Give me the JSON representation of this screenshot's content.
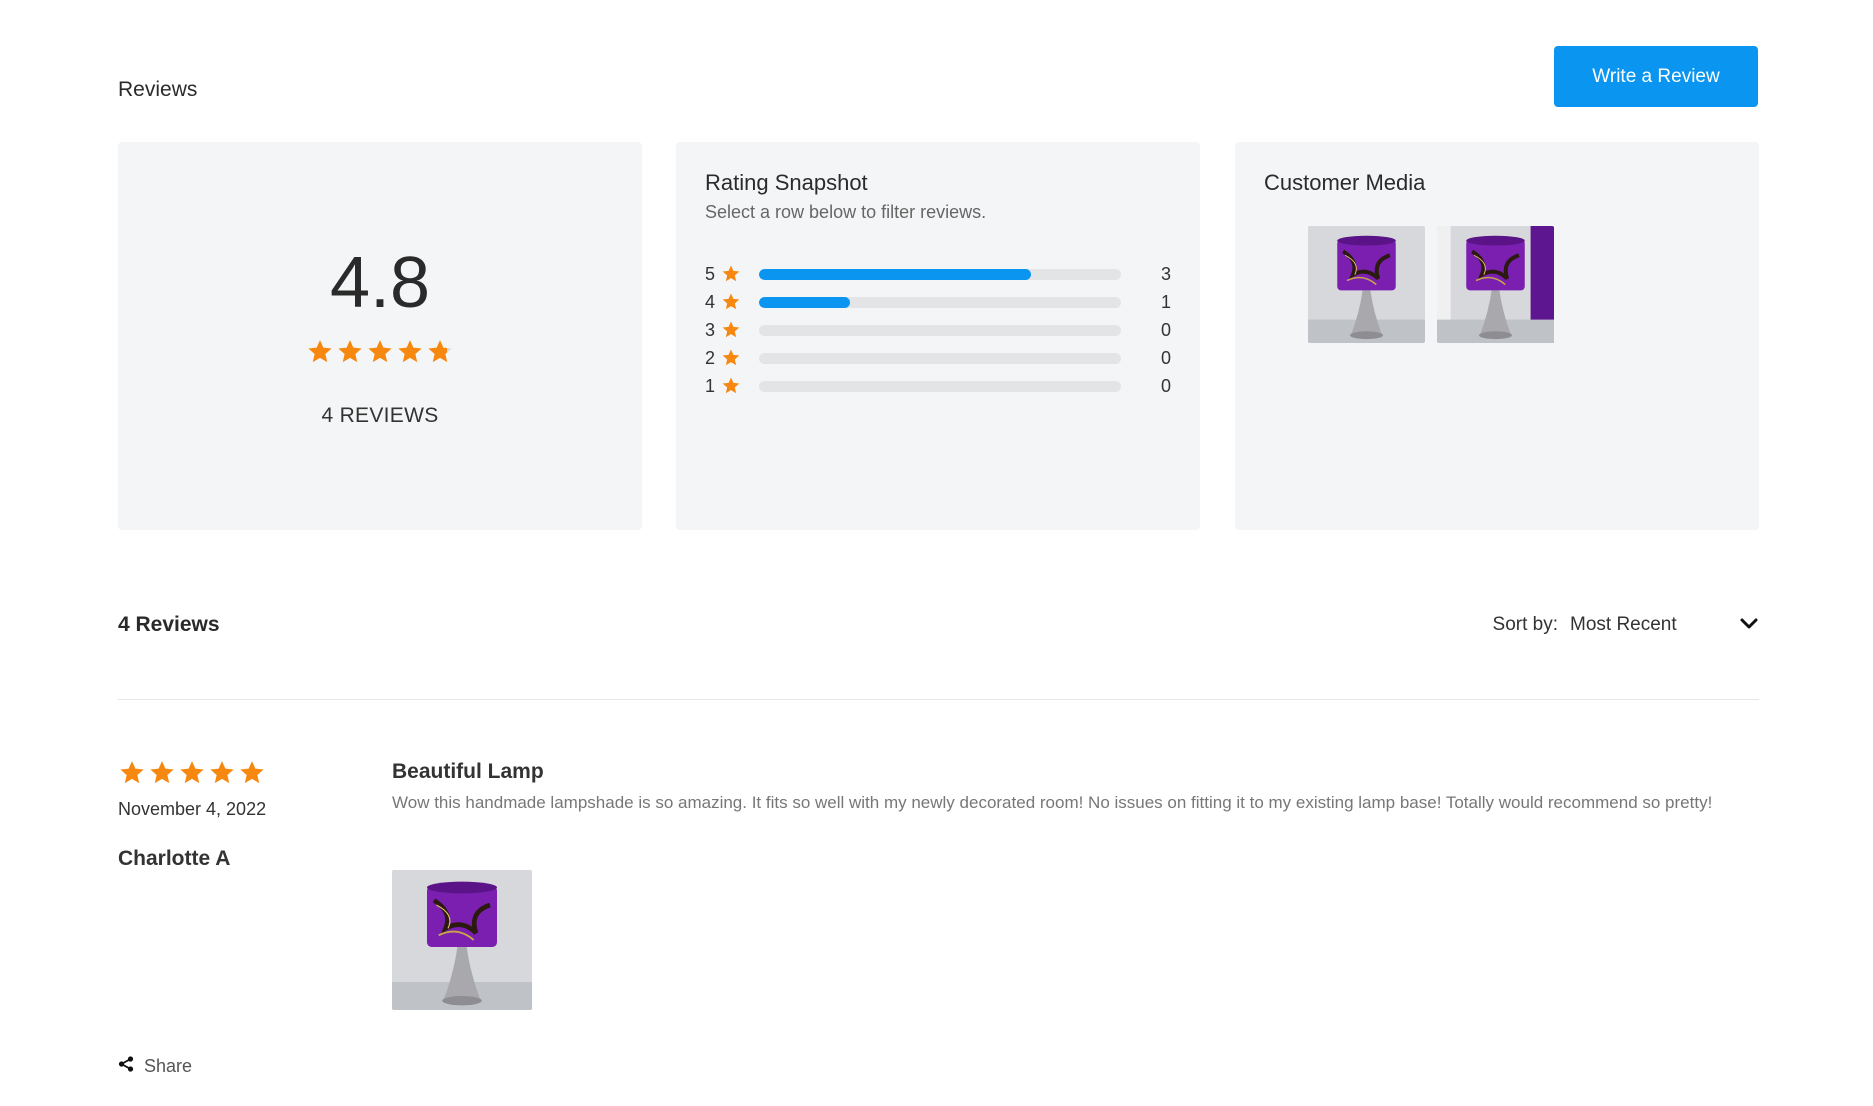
{
  "header": {
    "title": "Reviews",
    "write_button": "Write a Review"
  },
  "summary": {
    "average": "4.8",
    "rating": 4.8,
    "max_rating": 5,
    "count_label": "4 REVIEWS"
  },
  "snapshot": {
    "title": "Rating Snapshot",
    "subtitle": "Select a row below to filter reviews.",
    "rows": [
      {
        "level": "5",
        "count": "3",
        "fraction": 0.75
      },
      {
        "level": "4",
        "count": "1",
        "fraction": 0.25
      },
      {
        "level": "3",
        "count": "0",
        "fraction": 0
      },
      {
        "level": "2",
        "count": "0",
        "fraction": 0
      },
      {
        "level": "1",
        "count": "0",
        "fraction": 0
      }
    ]
  },
  "media": {
    "title": "Customer Media",
    "thumbnails": [
      "lampshade-photo",
      "lampshade-photo"
    ]
  },
  "list": {
    "count_label": "4 Reviews",
    "sort_label": "Sort by:",
    "sort_value": "Most Recent"
  },
  "review": {
    "rating": 5,
    "date": "November 4, 2022",
    "author": "Charlotte A",
    "title": "Beautiful Lamp",
    "body": "Wow this handmade lampshade is so amazing. It fits so well with my newly decorated room! No issues on fitting it to my existing lamp base! Totally would recommend so pretty!"
  },
  "share_label": "Share",
  "colors": {
    "accent": "#0a95f0",
    "star": "#f7880f",
    "card_bg": "#f4f5f6",
    "lampshade": "#7a1fb0"
  }
}
